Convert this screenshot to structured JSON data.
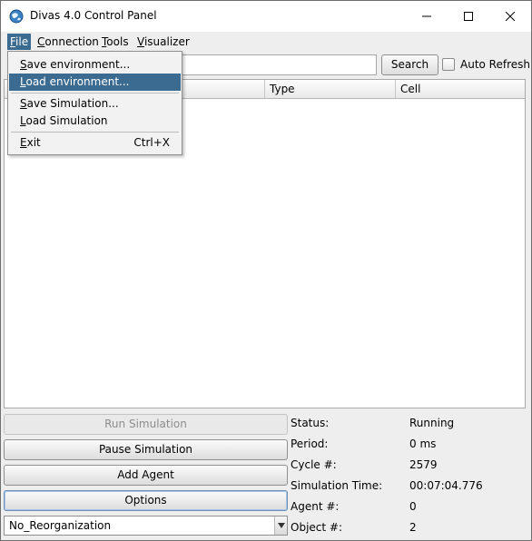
{
  "window": {
    "title": "Divas 4.0 Control Panel"
  },
  "menubar": {
    "items": [
      {
        "label": "File",
        "mnemonic": "F",
        "rest": "ile",
        "active": true
      },
      {
        "label": "Connection",
        "mnemonic": "C",
        "rest": "onnection"
      },
      {
        "label": "Tools",
        "mnemonic": "T",
        "rest": "ools"
      },
      {
        "label": "Visualizer",
        "mnemonic": "V",
        "rest": "isualizer"
      }
    ]
  },
  "file_menu": {
    "items": [
      {
        "mnemonic": "S",
        "rest": "ave environment..."
      },
      {
        "mnemonic": "L",
        "rest": "oad environment..."
      },
      {
        "mnemonic": "S",
        "rest": "ave Simulation..."
      },
      {
        "mnemonic": "L",
        "rest": "oad Simulation"
      },
      {
        "mnemonic": "E",
        "rest": "xit",
        "shortcut": "Ctrl+X"
      }
    ]
  },
  "toolbar": {
    "search_value": "",
    "search_label": "Search",
    "auto_refresh_label": "Auto Refresh"
  },
  "table": {
    "columns": [
      "",
      "Type",
      "Cell"
    ]
  },
  "controls": {
    "run_label": "Run Simulation",
    "pause_label": "Pause Simulation",
    "add_agent_label": "Add Agent",
    "options_label": "Options",
    "reorg_value": "No_Reorganization"
  },
  "status": {
    "status_label": "Status:",
    "status_value": "Running",
    "period_label": "Period:",
    "period_value": "0 ms",
    "cycle_label": "Cycle #:",
    "cycle_value": "2579",
    "simtime_label": "Simulation Time:",
    "simtime_value": "00:07:04.776",
    "agent_label": "Agent #:",
    "agent_value": "0",
    "object_label": "Object #:",
    "object_value": "2"
  },
  "colors": {
    "menu_highlight": "#3c6b91"
  },
  "icons": {
    "app": "globe-icon",
    "minimize": "minimize-icon",
    "maximize": "maximize-icon",
    "close": "close-icon",
    "dropdown": "triangle-down-icon"
  }
}
